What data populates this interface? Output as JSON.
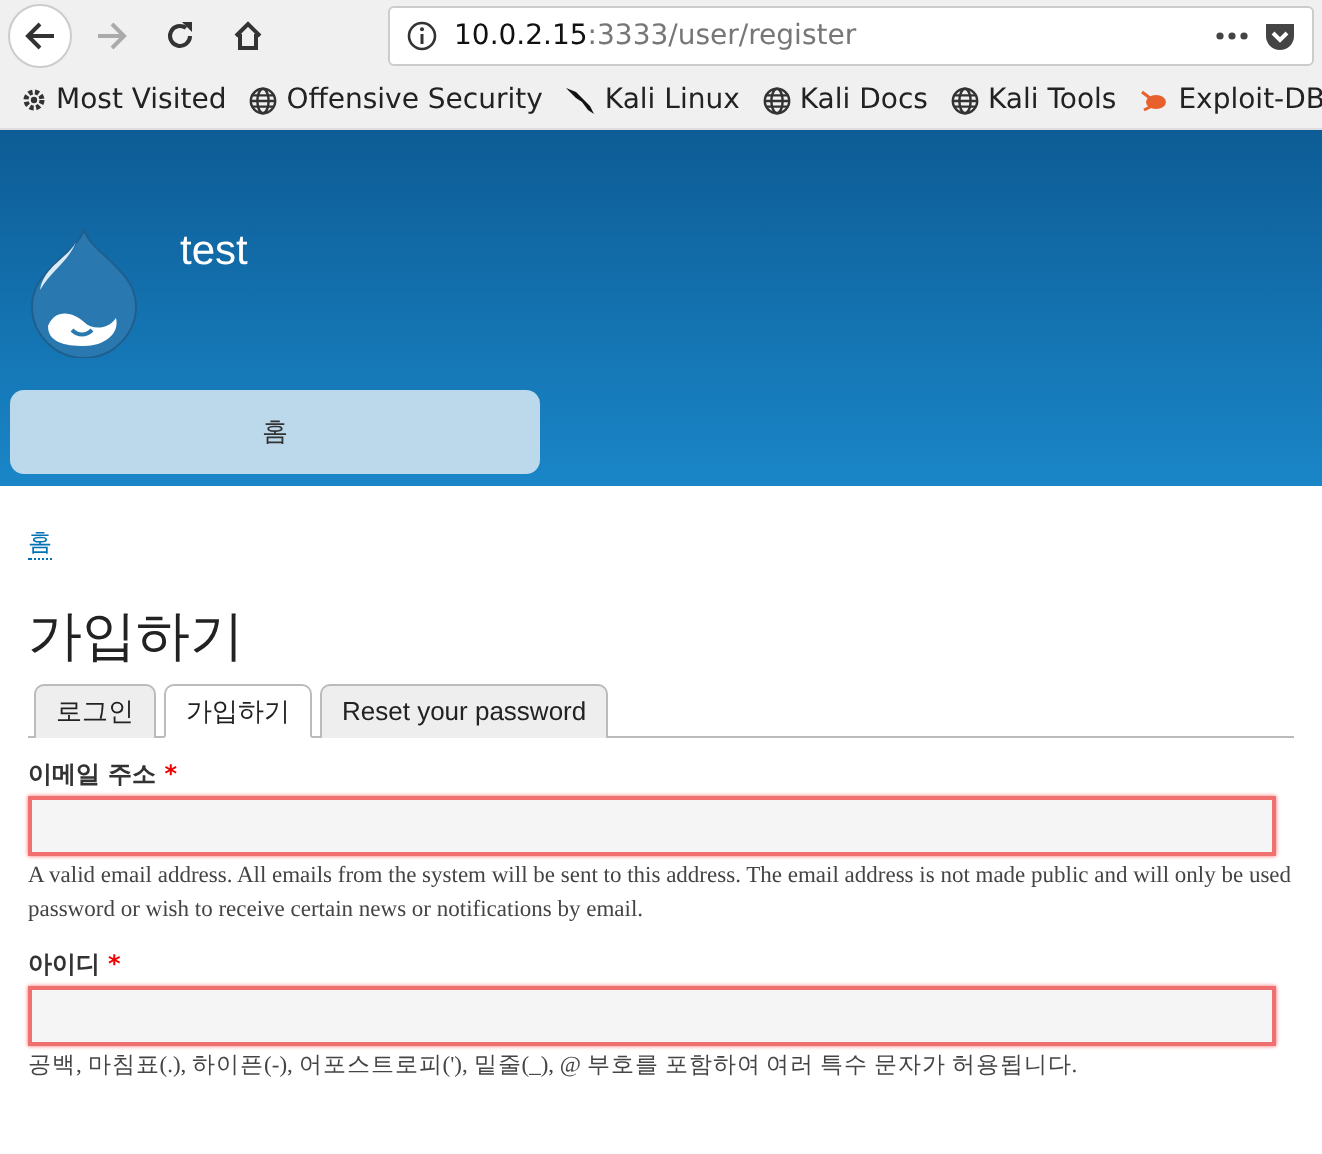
{
  "browser": {
    "url_host": "10.0.2.15",
    "url_path": ":3333/user/register",
    "bookmarks": [
      {
        "label": "Most Visited",
        "kind": "gear"
      },
      {
        "label": "Offensive Security",
        "kind": "globe"
      },
      {
        "label": "Kali Linux",
        "kind": "dragon"
      },
      {
        "label": "Kali Docs",
        "kind": "globe"
      },
      {
        "label": "Kali Tools",
        "kind": "globe"
      },
      {
        "label": "Exploit-DB",
        "kind": "bug"
      }
    ]
  },
  "site": {
    "name": "test",
    "nav": [
      {
        "label": "홈",
        "selected": true
      }
    ]
  },
  "breadcrumb": "홈",
  "page_title": "가입하기",
  "tabs": [
    {
      "label": "로그인",
      "selected": false
    },
    {
      "label": "가입하기",
      "selected": true
    },
    {
      "label": "Reset your password",
      "selected": false
    }
  ],
  "fields": [
    {
      "label": "이메일 주소",
      "required_mark": "*",
      "error": true,
      "help_lines": [
        "A valid email address. All emails from the system will be sent to this address. The email address is not made public and will only be used",
        "password or wish to receive certain news or notifications by email."
      ]
    },
    {
      "label": "아이디",
      "required_mark": "*",
      "error": true,
      "help_lines": [
        "공백, 마침표(.), 하이픈(-), 어포스트로피('), 밑줄(_), @ 부호를 포함하여 여러 특수 문자가 허용됩니다."
      ]
    }
  ]
}
